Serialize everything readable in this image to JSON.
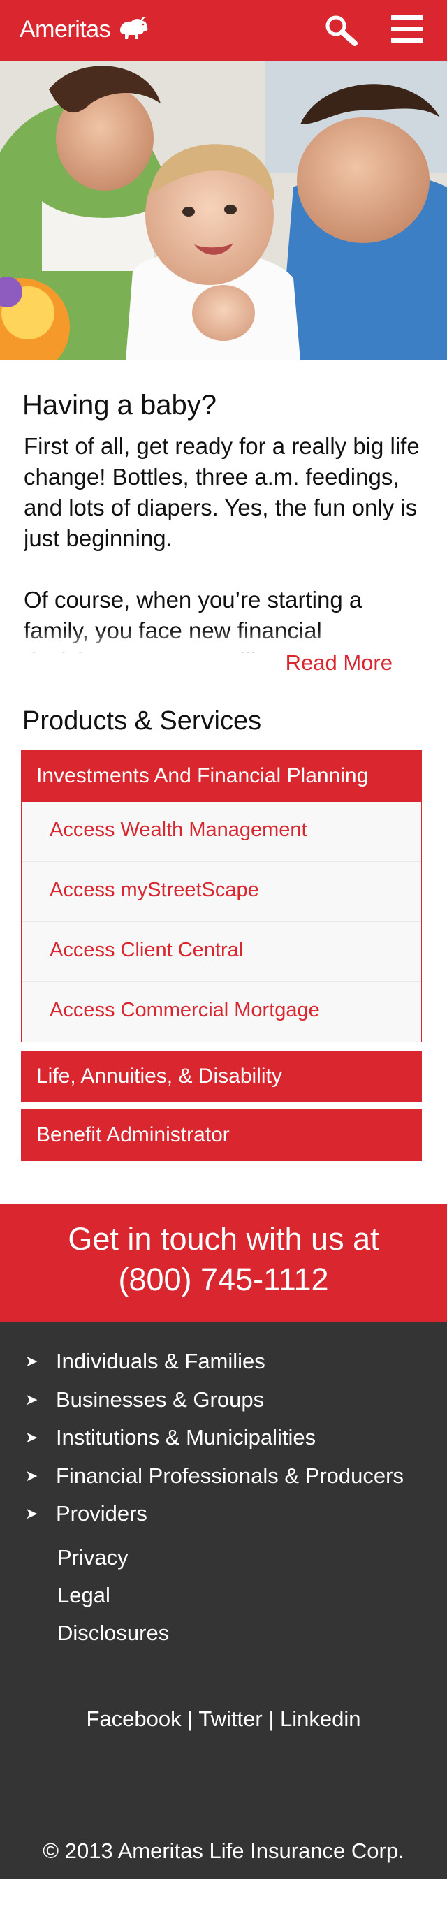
{
  "header": {
    "logo_text": "Ameritas",
    "logo_mark": "bison-icon",
    "search_icon": "search-icon",
    "menu_icon": "hamburger-menu-icon"
  },
  "hero": {
    "image": "family-with-baby-photo"
  },
  "intro": {
    "title": "Having a baby?",
    "paragraphs": [
      "First of all, get ready for a really big life change! Bottles, three a.m. feedings, and lots of diapers. Yes, the fun only is just beginning.",
      "Of course, when you’re starting a family, you face new financial decisions. Expenses like a new ..."
    ],
    "read_more": "Read More"
  },
  "products": {
    "title": "Products & Services",
    "sections": [
      {
        "label": "Investments And Financial Planning",
        "expanded": true,
        "items": [
          "Access Wealth Management",
          "Access myStreetScape",
          "Access Client Central",
          "Access Commercial Mortgage"
        ]
      },
      {
        "label": "Life, Annuities, & Disability",
        "expanded": false
      },
      {
        "label": "Benefit Administrator",
        "expanded": false
      }
    ]
  },
  "contact": {
    "line1": "Get in touch with us at",
    "phone": "(800) 745-1112"
  },
  "footer": {
    "nav": [
      "Individuals & Families",
      "Businesses & Groups",
      "Institutions & Municipalities",
      "Financial Professionals & Producers",
      "Providers"
    ],
    "links": [
      "Privacy",
      "Legal",
      "Disclosures"
    ],
    "social": [
      "Facebook",
      "Twitter",
      "Linkedin"
    ],
    "separator": "|",
    "arrow": "➤",
    "copyright": "© 2013 Ameritas Life Insurance Corp."
  },
  "colors": {
    "brand_red": "#d9262f",
    "footer_bg": "#343434",
    "text_dark": "#111111"
  }
}
